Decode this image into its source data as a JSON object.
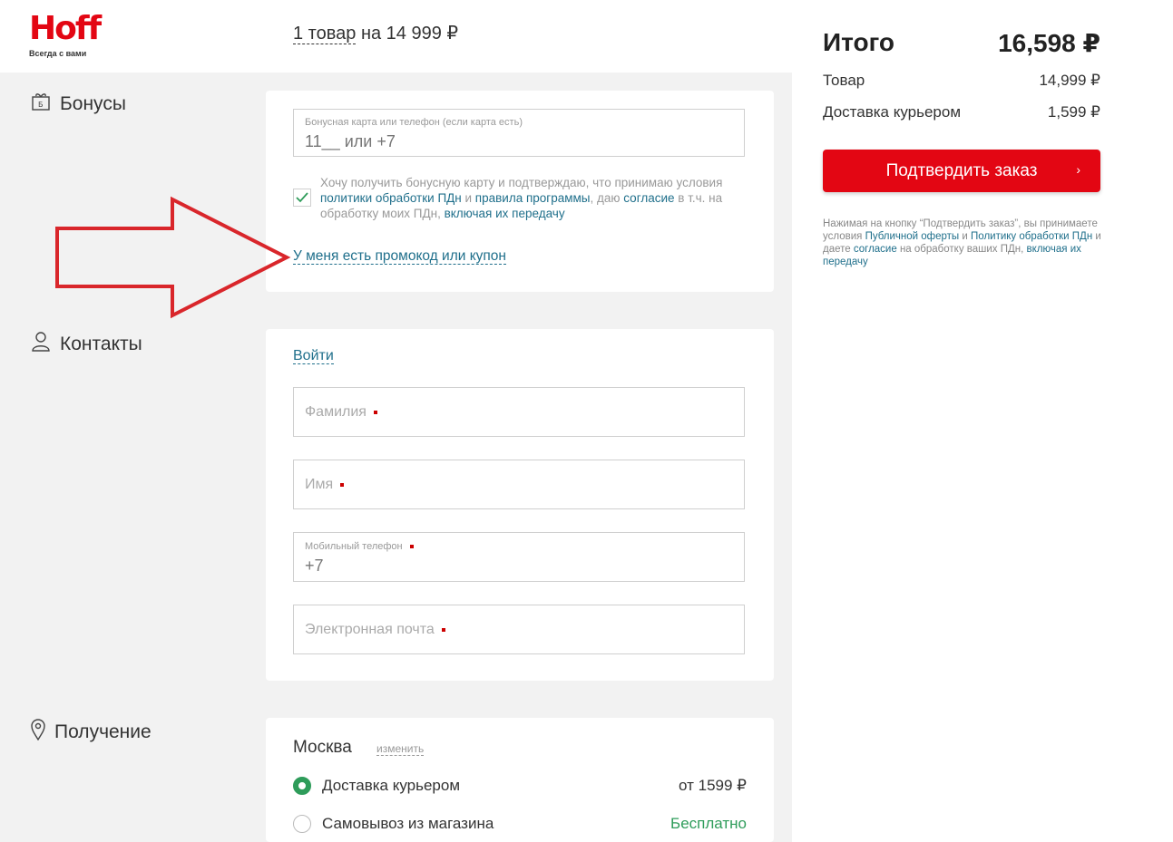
{
  "header": {
    "logo_text": "Hoff",
    "logo_tagline": "Всегда с вами",
    "cart_count": "1 товар",
    "cart_sum": " на 14 999 ₽"
  },
  "bonuses": {
    "title": "Бонусы",
    "card_label": "Бонусная карта или телефон (если карта есть)",
    "card_value": "11__ или +7",
    "consent_parts": {
      "a": "Хочу получить бонусную карту и подтверждаю, что принимаю условия ",
      "link1": "политики обработки ПДн",
      "b": " и ",
      "link2": "правила программы",
      "c": ", даю ",
      "link3": "согласие",
      "d": " в т.ч. на обработку моих ПДн, ",
      "link4": "включая их передачу"
    },
    "promo_link": "У меня есть промокод или купон"
  },
  "contacts": {
    "title": "Контакты",
    "login_link": "Войти",
    "surname_placeholder": "Фамилия",
    "name_placeholder": "Имя",
    "phone_label": "Мобильный телефон",
    "phone_value": "+7",
    "email_placeholder": "Электронная почта"
  },
  "delivery": {
    "title": "Получение",
    "city": "Москва",
    "change_link": "изменить",
    "options": [
      {
        "label": "Доставка курьером",
        "price": "от 1599 ₽",
        "selected": true
      },
      {
        "label": "Самовывоз из магазина",
        "price": "Бесплатно",
        "selected": false
      }
    ]
  },
  "summary": {
    "title": "Итого",
    "total": "16,598 ₽",
    "rows": [
      {
        "label": "Товар",
        "value": "14,999 ₽"
      },
      {
        "label": "Доставка курьером",
        "value": "1,599 ₽"
      }
    ],
    "confirm_label": "Подтвердить заказ",
    "fine_parts": {
      "a": "Нажимая на кнопку “Подтвердить заказ”, вы принимаете условия ",
      "link1": "Публичной оферты",
      "b": " и ",
      "link2": "Политику обработки ПДн",
      "c": " и даете ",
      "link3": "согласие",
      "d": " на обработку ваших ПДн, ",
      "link4": "включая их передачу"
    }
  },
  "colors": {
    "brand_red": "#e30613",
    "link_blue": "#1f6f8b",
    "free_green": "#2e9c5a",
    "arrow_red": "#d9262b"
  }
}
